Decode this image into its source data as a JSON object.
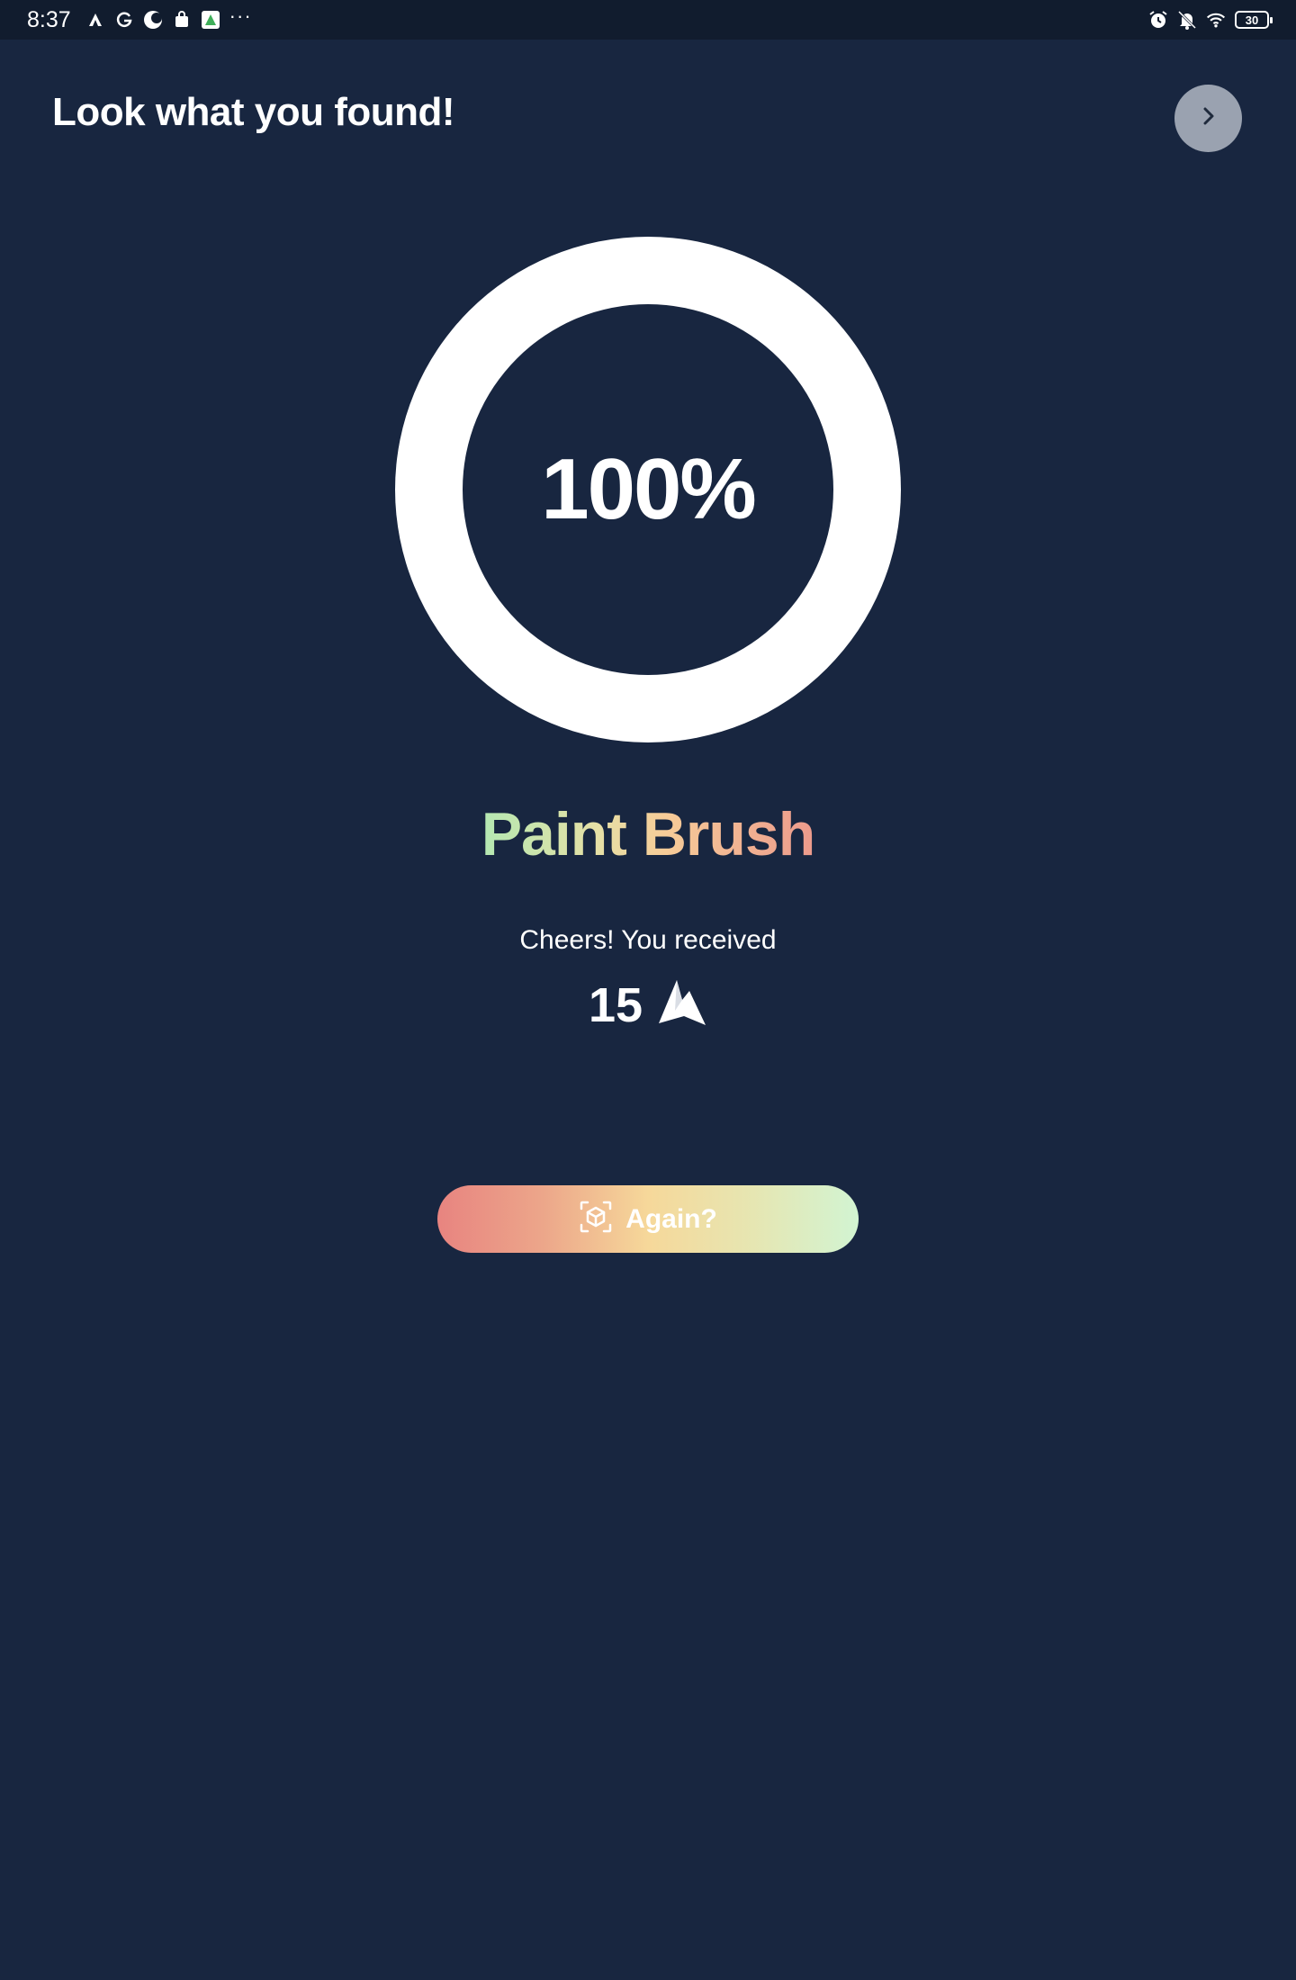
{
  "status_bar": {
    "time": "8:37",
    "battery": "30",
    "more": "···",
    "left_icons": [
      "app-a-icon",
      "google-icon",
      "moon-app-icon",
      "shopping-bag-icon",
      "green-app-icon"
    ],
    "right_icons": [
      "alarm-icon",
      "mute-icon",
      "wifi-icon",
      "battery-icon"
    ]
  },
  "header": {
    "title": "Look what you found!",
    "next_icon": "chevron-right-icon"
  },
  "progress": {
    "value": 1.0,
    "label": "100%"
  },
  "item": {
    "name": "Paint Brush",
    "gradient": [
      "#b4e8b2",
      "#e6e0a6",
      "#f6cc98",
      "#ec9a8c"
    ]
  },
  "reward": {
    "message": "Cheers! You received",
    "amount": "15",
    "icon": "mountain-token-icon"
  },
  "again_button": {
    "label": "Again?",
    "icon": "ar-cube-scan-icon",
    "gradient": [
      "#e88480",
      "#f6d89a",
      "#d2f4d2"
    ]
  },
  "colors": {
    "background": "#182640",
    "status_bar": "#111c2e",
    "next_button": "#9aa2b0",
    "ring": "#ffffff"
  }
}
